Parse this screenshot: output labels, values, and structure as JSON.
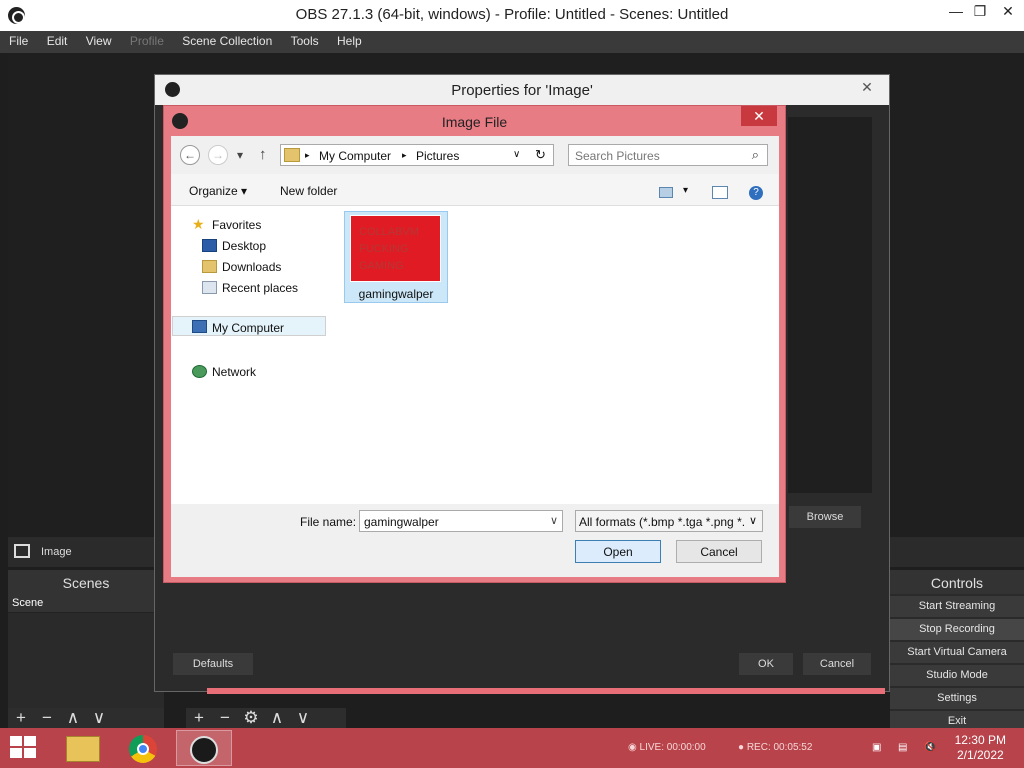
{
  "obs": {
    "window_title": "OBS 27.1.3 (64-bit, windows) - Profile: Untitled - Scenes: Untitled",
    "menu": [
      "File",
      "Edit",
      "View",
      "Profile",
      "Scene Collection",
      "Tools",
      "Help"
    ],
    "source_label": "Image",
    "scenes": {
      "title": "Scenes",
      "items": [
        "Scene"
      ]
    },
    "dock_tools": [
      "+",
      "−",
      "∧",
      "∨"
    ],
    "sources_tools": [
      "+",
      "−",
      "⚙",
      "∧",
      "∨"
    ],
    "controls": {
      "title": "Controls",
      "buttons": [
        "Start Streaming",
        "Stop Recording",
        "Start Virtual Camera",
        "Studio Mode",
        "Settings",
        "Exit"
      ]
    }
  },
  "properties": {
    "title": "Properties for 'Image'",
    "browse": "Browse",
    "defaults": "Defaults",
    "ok": "OK",
    "cancel": "Cancel"
  },
  "file_dialog": {
    "title": "Image File",
    "breadcrumb": [
      "My Computer",
      "Pictures"
    ],
    "search_placeholder": "Search Pictures",
    "toolbar": {
      "organize": "Organize",
      "new_folder": "New folder"
    },
    "tree": {
      "favorites": "Favorites",
      "desktop": "Desktop",
      "downloads": "Downloads",
      "recent": "Recent places",
      "computer": "My Computer",
      "network": "Network"
    },
    "file": {
      "name": "gamingwalper",
      "thumb_lines": [
        "COLLABVM",
        "FUCKING",
        "GAMING"
      ]
    },
    "filename_label": "File name:",
    "filename_value": "gamingwalper",
    "filetype_value": "All formats (*.bmp *.tga *.png *.",
    "open": "Open",
    "cancel": "Cancel"
  },
  "taskbar": {
    "live": "LIVE: 00:00:00",
    "rec": "REC: 00:05:52",
    "time": "12:30 PM",
    "date": "2/1/2022"
  },
  "colors": {
    "accent": "#e87c85",
    "taskbar": "#b8434b",
    "close": "#c7393f"
  }
}
